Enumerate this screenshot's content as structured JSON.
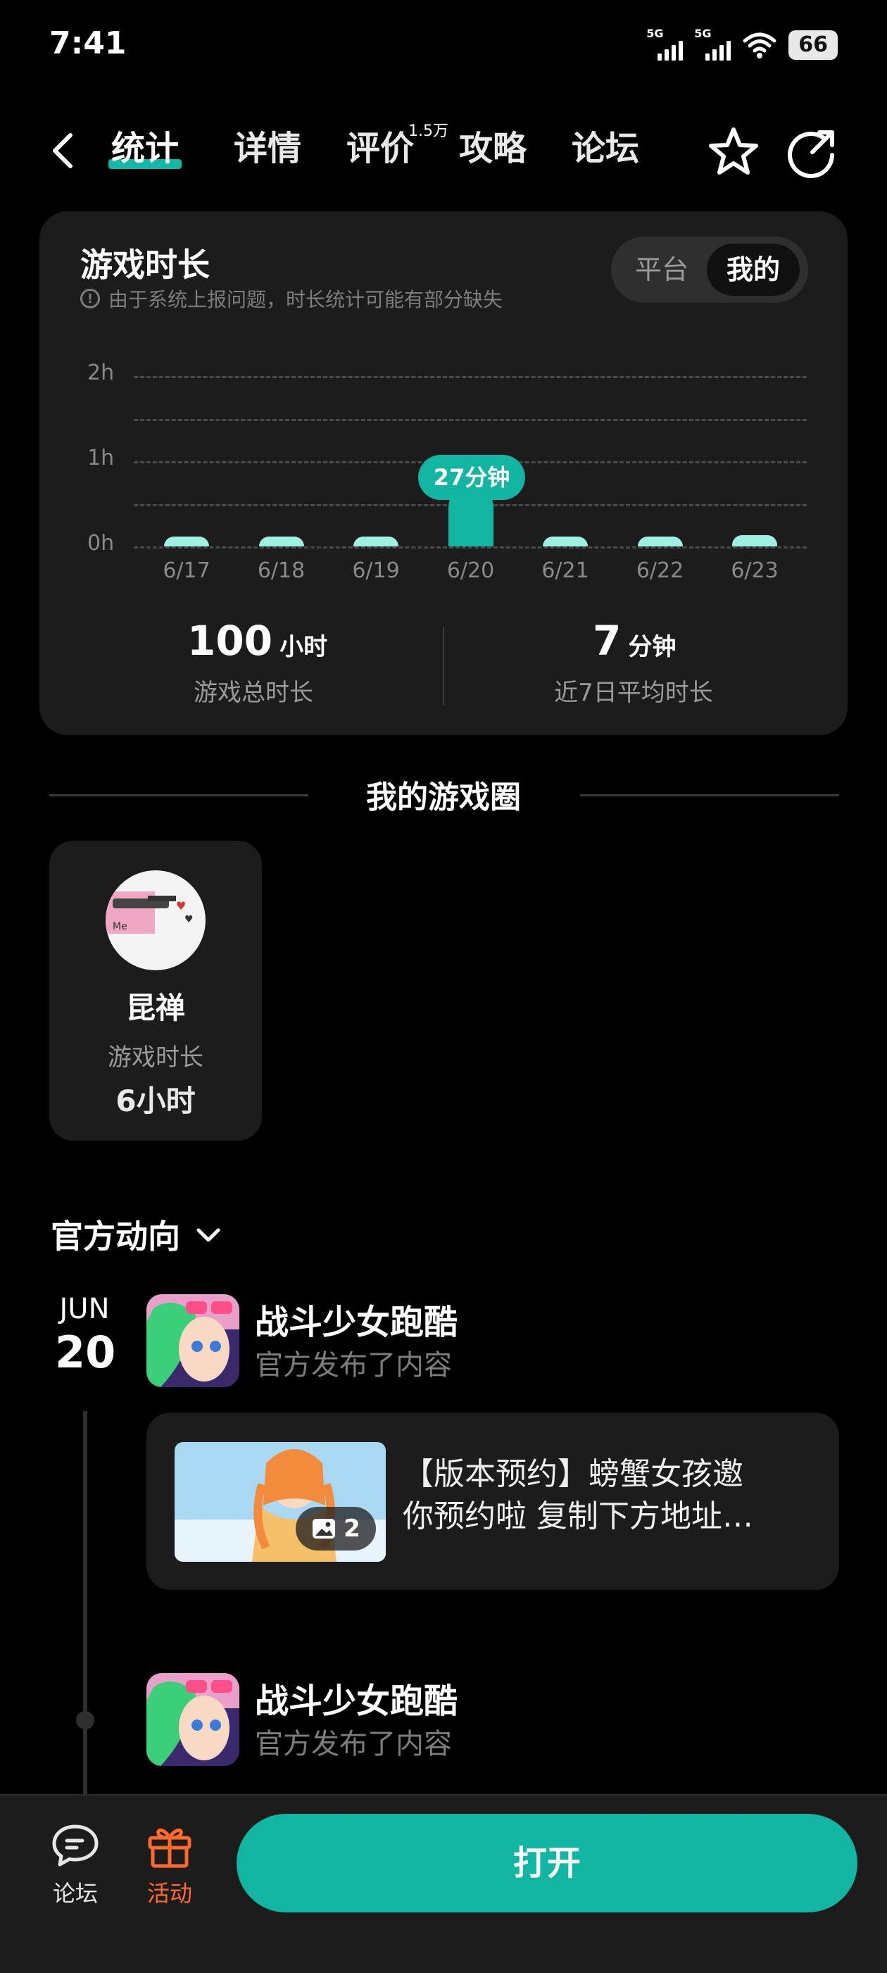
{
  "status_bar": {
    "time": "7:41",
    "sim1": "5G",
    "sim2": "5G",
    "battery": "66"
  },
  "nav": {
    "tabs": [
      {
        "label": "统计",
        "active": true
      },
      {
        "label": "详情"
      },
      {
        "label": "评价"
      },
      {
        "label": "攻略"
      },
      {
        "label": "论坛"
      }
    ],
    "review_count": "1.5万",
    "icons": [
      "back-icon",
      "star-icon",
      "share-icon"
    ]
  },
  "playtime": {
    "title": "游戏时长",
    "note": "由于系统上报问题，时长统计可能有部分缺失",
    "toggle": {
      "platform": "平台",
      "mine": "我的",
      "selected": "我的"
    },
    "tooltip": "27分钟",
    "total": {
      "value": "100",
      "unit": "小时",
      "label": "游戏总时长"
    },
    "average": {
      "value": "7",
      "unit": "分钟",
      "label": "近7日平均时长"
    }
  },
  "chart_data": {
    "type": "bar",
    "title": "游戏时长",
    "categories": [
      "6/17",
      "6/18",
      "6/19",
      "6/20",
      "6/21",
      "6/22",
      "6/23"
    ],
    "values": [
      0,
      0,
      0,
      27,
      0,
      0,
      5
    ],
    "unit": "分钟",
    "yticks": [
      "0h",
      "1h",
      "2h"
    ],
    "ylim": [
      0,
      120
    ],
    "highlight_index": 3,
    "colors": {
      "bar": "#9ef0e0",
      "highlight": "#11b5a1"
    }
  },
  "game_circle": {
    "section_title": "我的游戏圈",
    "card": {
      "name": "昆禅",
      "meta_label": "游戏时长",
      "meta_value": "6小时"
    }
  },
  "official": {
    "header": "官方动向",
    "date": {
      "month": "JUN",
      "day": "20"
    },
    "items": [
      {
        "game": "战斗少女跑酷",
        "action": "官方发布了内容"
      },
      {
        "game": "战斗少女跑酷",
        "action": "官方发布了内容"
      }
    ],
    "post": {
      "line1": "【版本预约】螃蟹女孩邀",
      "line2": "你预约啦 复制下方地址…",
      "image_count": "2"
    }
  },
  "bottom_bar": {
    "forum": "论坛",
    "activity": "活动",
    "open": "打开"
  },
  "colors": {
    "accent": "#11b5a1",
    "activity": "#ff6a2a",
    "card": "#1c1c1c"
  }
}
